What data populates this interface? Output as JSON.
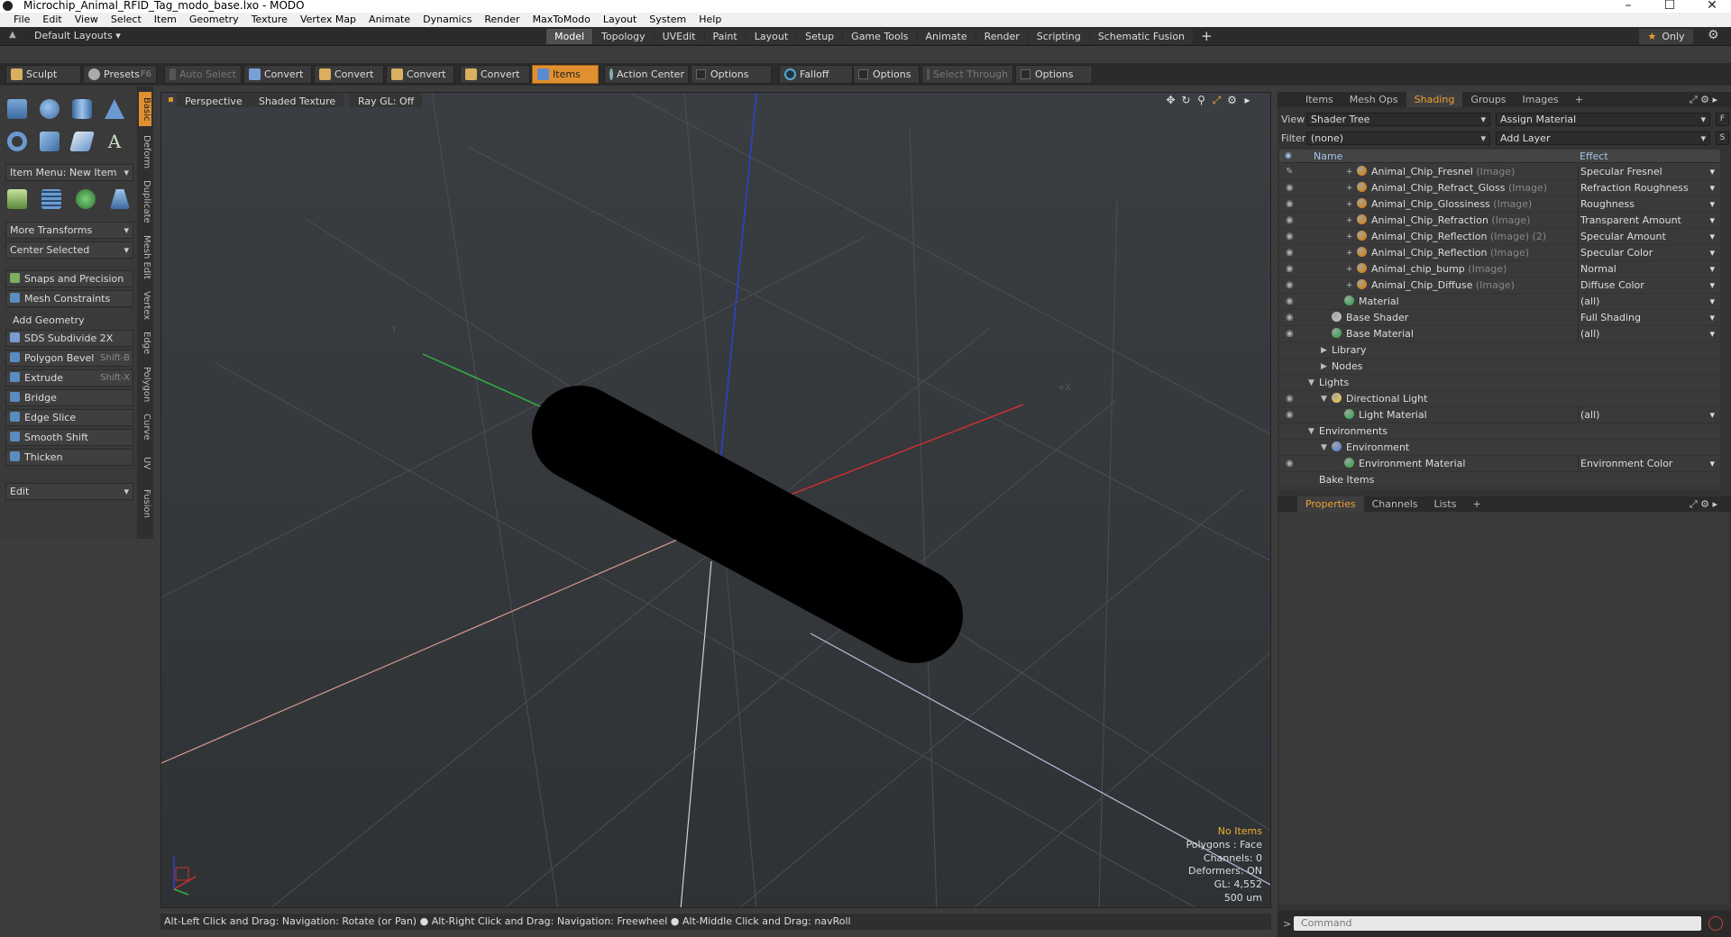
{
  "window": {
    "title": "Microchip_Animal_RFID_Tag_modo_base.lxo - MODO",
    "min": "–",
    "max": "☐",
    "close": "✕"
  },
  "menu": [
    "File",
    "Edit",
    "View",
    "Select",
    "Item",
    "Geometry",
    "Texture",
    "Vertex Map",
    "Animate",
    "Dynamics",
    "Render",
    "MaxToModo",
    "Layout",
    "System",
    "Help"
  ],
  "layouts": "Default Layouts ▾",
  "layout_tabs": [
    "Model",
    "Topology",
    "UVEdit",
    "Paint",
    "Layout",
    "Setup",
    "Game Tools",
    "Animate",
    "Render",
    "Scripting",
    "Schematic Fusion"
  ],
  "active_layout_tab": "Model",
  "only_label": "Only",
  "toolbar": {
    "sculpt": "Sculpt",
    "presets": "Presets",
    "presets_key": "F6",
    "auto_select": "Auto Select",
    "convert1": "Convert",
    "convert2": "Convert",
    "convert3": "Convert",
    "convert4": "Convert",
    "items": "Items",
    "action_center": "Action Center",
    "options1": "Options",
    "falloff": "Falloff",
    "options2": "Options",
    "select_through": "Select Through",
    "options3": "Options"
  },
  "left": {
    "item_menu": "Item Menu: New Item",
    "more_transforms": "More Transforms",
    "center_selected": "Center Selected",
    "snaps": "Snaps and Precision",
    "mesh_constraints": "Mesh Constraints",
    "add_geometry": "Add Geometry",
    "tools": [
      {
        "label": "SDS Subdivide 2X",
        "key": ""
      },
      {
        "label": "Polygon Bevel",
        "key": "Shift-B"
      },
      {
        "label": "Extrude",
        "key": "Shift-X"
      },
      {
        "label": "Bridge",
        "key": ""
      },
      {
        "label": "Edge Slice",
        "key": ""
      },
      {
        "label": "Smooth Shift",
        "key": ""
      },
      {
        "label": "Thicken",
        "key": ""
      }
    ],
    "edit": "Edit",
    "side_tabs": [
      "Basic",
      "Deform",
      "Duplicate",
      "Mesh Edit",
      "Vertex",
      "Edge",
      "Polygon",
      "Curve",
      "UV",
      "Fusion"
    ]
  },
  "viewport": {
    "perspective": "Perspective",
    "shading": "Shaded Texture",
    "raygl": "Ray GL: Off",
    "info": {
      "no_items": "No Items",
      "polygons": "Polygons : Face",
      "channels": "Channels: 0",
      "deformers": "Deformers: ON",
      "gl": "GL: 4,552",
      "units": "500 um"
    }
  },
  "status": "Alt-Left Click and Drag: Navigation: Rotate (or Pan) ●  Alt-Right Click and Drag: Navigation: Freewheel ●  Alt-Middle Click and Drag: navRoll",
  "right": {
    "top_tabs": [
      "Items",
      "Mesh Ops",
      "Shading",
      "Groups",
      "Images"
    ],
    "active_top_tab": "Shading",
    "view_label": "View",
    "view_value": "Shader Tree",
    "assign_material": "Assign Material",
    "filter_label": "Filter",
    "filter_value": "(none)",
    "add_layer": "Add Layer",
    "col_name": "Name",
    "col_effect": "Effect",
    "tree": [
      {
        "name": "Animal_Chip_Fresnel",
        "suffix": " (Image)",
        "effect": "Specular Fresnel",
        "indent": 4,
        "exp": "+",
        "ball": "#c88a2a",
        "eye": "✎",
        "dd": true
      },
      {
        "name": "Animal_Chip_Refract_Gloss",
        "suffix": " (Image)",
        "effect": "Refraction Roughness",
        "indent": 4,
        "exp": "+",
        "ball": "#c88a2a",
        "eye": "◉",
        "dd": true
      },
      {
        "name": "Animal_Chip_Glossiness",
        "suffix": " (Image)",
        "effect": "Roughness",
        "indent": 4,
        "exp": "+",
        "ball": "#c88a2a",
        "eye": "◉",
        "dd": true
      },
      {
        "name": "Animal_Chip_Refraction",
        "suffix": " (Image)",
        "effect": "Transparent Amount",
        "indent": 4,
        "exp": "+",
        "ball": "#c88a2a",
        "eye": "◉",
        "dd": true
      },
      {
        "name": "Animal_Chip_Reflection",
        "suffix": " (Image) (2)",
        "effect": "Specular Amount",
        "indent": 4,
        "exp": "+",
        "ball": "#c88a2a",
        "eye": "◉",
        "dd": true
      },
      {
        "name": "Animal_Chip_Reflection",
        "suffix": " (Image)",
        "effect": "Specular Color",
        "indent": 4,
        "exp": "+",
        "ball": "#c88a2a",
        "eye": "◉",
        "dd": true
      },
      {
        "name": "Animal_chip_bump",
        "suffix": " (Image)",
        "effect": "Normal",
        "indent": 4,
        "exp": "+",
        "ball": "#c88a2a",
        "eye": "◉",
        "dd": true
      },
      {
        "name": "Animal_Chip_Diffuse",
        "suffix": " (Image)",
        "effect": "Diffuse Color",
        "indent": 4,
        "exp": "+",
        "ball": "#c88a2a",
        "eye": "◉",
        "dd": true
      },
      {
        "name": "Material",
        "suffix": "",
        "effect": "(all)",
        "indent": 3,
        "exp": "",
        "ball": "#4aa860",
        "eye": "◉",
        "dd": true
      },
      {
        "name": "Base Shader",
        "suffix": "",
        "effect": "Full Shading",
        "indent": 2,
        "exp": "",
        "ball": "#bbbbbb",
        "eye": "◉",
        "dd": true
      },
      {
        "name": "Base Material",
        "suffix": "",
        "effect": "(all)",
        "indent": 2,
        "exp": "",
        "ball": "#4aa860",
        "eye": "◉",
        "dd": true
      },
      {
        "name": "Library",
        "suffix": "",
        "effect": "",
        "indent": 2,
        "exp": "▶",
        "ball": "",
        "eye": "",
        "dd": false
      },
      {
        "name": "Nodes",
        "suffix": "",
        "effect": "",
        "indent": 2,
        "exp": "▶",
        "ball": "",
        "eye": "",
        "dd": false
      },
      {
        "name": "Lights",
        "suffix": "",
        "effect": "",
        "indent": 1,
        "exp": "▼",
        "ball": "",
        "eye": "",
        "dd": false
      },
      {
        "name": "Directional Light",
        "suffix": "",
        "effect": "",
        "indent": 2,
        "exp": "▼",
        "ball": "#e0c060",
        "eye": "◉",
        "dd": false
      },
      {
        "name": "Light Material",
        "suffix": "",
        "effect": "(all)",
        "indent": 3,
        "exp": "",
        "ball": "#4aa860",
        "eye": "◉",
        "dd": true
      },
      {
        "name": "Environments",
        "suffix": "",
        "effect": "",
        "indent": 1,
        "exp": "▼",
        "ball": "",
        "eye": "",
        "dd": false
      },
      {
        "name": "Environment",
        "suffix": "",
        "effect": "",
        "indent": 2,
        "exp": "▼",
        "ball": "#6a8ad0",
        "eye": "",
        "dd": false
      },
      {
        "name": "Environment Material",
        "suffix": "",
        "effect": "Environment Color",
        "indent": 3,
        "exp": "",
        "ball": "#4aa860",
        "eye": "◉",
        "dd": true
      },
      {
        "name": "Bake Items",
        "suffix": "",
        "effect": "",
        "indent": 1,
        "exp": "",
        "ball": "",
        "eye": "",
        "dd": false
      }
    ],
    "bottom_tabs": [
      "Properties",
      "Channels",
      "Lists"
    ],
    "active_bottom_tab": "Properties",
    "command_placeholder": "Command"
  },
  "colors": {
    "accent": "#e09030",
    "selected_tab": "#f0a030",
    "x_axis": "#cc3030",
    "y_axis": "#30b040",
    "z_axis": "#3040d0"
  }
}
